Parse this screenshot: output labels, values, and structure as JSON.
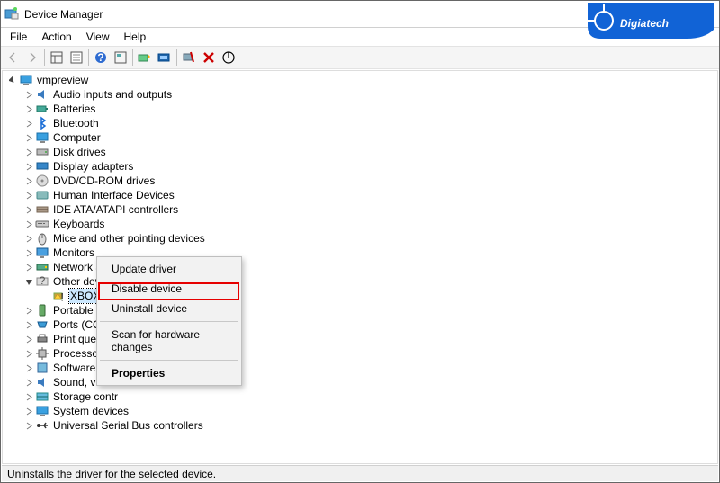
{
  "window": {
    "title": "Device Manager"
  },
  "menu": {
    "file": "File",
    "action": "Action",
    "view": "View",
    "help": "Help"
  },
  "tree": {
    "root": "vmpreview",
    "categories": [
      "Audio inputs and outputs",
      "Batteries",
      "Bluetooth",
      "Computer",
      "Disk drives",
      "Display adapters",
      "DVD/CD-ROM drives",
      "Human Interface Devices",
      "IDE ATA/ATAPI controllers",
      "Keyboards",
      "Mice and other pointing devices",
      "Monitors",
      "Network adapters",
      "Other devices",
      "Portable Devi",
      "Ports (COM &",
      "Print queues",
      "Processors",
      "Software devi",
      "Sound, video",
      "Storage contr",
      "System devices",
      "Universal Serial Bus controllers"
    ],
    "other_child": "XBOX ACC"
  },
  "context_menu": {
    "update": "Update driver",
    "disable": "Disable device",
    "uninstall": "Uninstall device",
    "scan": "Scan for hardware changes",
    "properties": "Properties"
  },
  "status": "Uninstalls the driver for the selected device.",
  "watermark": "Digiatech"
}
